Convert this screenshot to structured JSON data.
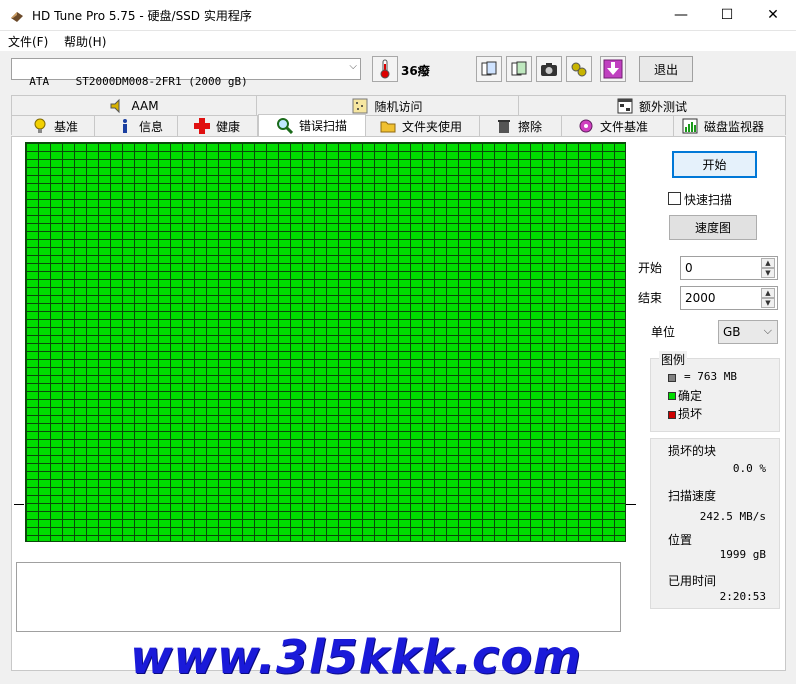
{
  "window": {
    "title": "HD Tune Pro 5.75 - 硬盘/SSD 实用程序",
    "minimize": "—",
    "maximize": "☐",
    "close": "✕"
  },
  "menu": {
    "file": "文件(F)",
    "help": "帮助(H)"
  },
  "toolbar": {
    "drive": "ATA    ST2000DM008-2FR1 (2000 gB)",
    "temperature": "36癈",
    "exit_label": "退出"
  },
  "tabs_top": [
    {
      "label": "AAM",
      "icon": "speaker-icon"
    },
    {
      "label": "随机访问",
      "icon": "random-access-icon"
    },
    {
      "label": "额外测试",
      "icon": "extra-tests-icon"
    }
  ],
  "tabs_bottom": [
    {
      "label": "基准",
      "icon": "lightbulb-icon"
    },
    {
      "label": "信息",
      "icon": "info-icon"
    },
    {
      "label": "健康",
      "icon": "health-cross-icon"
    },
    {
      "label": "错误扫描",
      "icon": "magnifier-icon",
      "active": true
    },
    {
      "label": "文件夹使用",
      "icon": "folder-icon"
    },
    {
      "label": "擦除",
      "icon": "trash-icon"
    },
    {
      "label": "文件基准",
      "icon": "file-benchmark-icon"
    },
    {
      "label": "磁盘监视器",
      "icon": "disk-monitor-icon"
    }
  ],
  "scan": {
    "start_button": "开始",
    "quick_scan_label": "快速扫描",
    "quick_scan_checked": false,
    "speed_map_button": "速度图",
    "start_label": "开始",
    "start_value": "0",
    "end_label": "结束",
    "end_value": "2000",
    "unit_label": "单位",
    "unit_value": "GB"
  },
  "legend": {
    "title": "图例",
    "block_size": "= 763 MB",
    "ok": "确定",
    "damaged": "损坏"
  },
  "stats": {
    "damaged_blocks_label": "损坏的块",
    "damaged_blocks_value": "0.0 %",
    "scan_speed_label": "扫描速度",
    "scan_speed_value": "242.5 MB/s",
    "position_label": "位置",
    "position_value": "1999 gB",
    "elapsed_label": "已用时间",
    "elapsed_value": "2:20:53"
  },
  "colors": {
    "ok_block": "#00dd00",
    "damaged_block": "#cc0000",
    "block_size_swatch": "#808080",
    "focus": "#0078d7"
  },
  "watermark": "www.3l5kkk.com"
}
